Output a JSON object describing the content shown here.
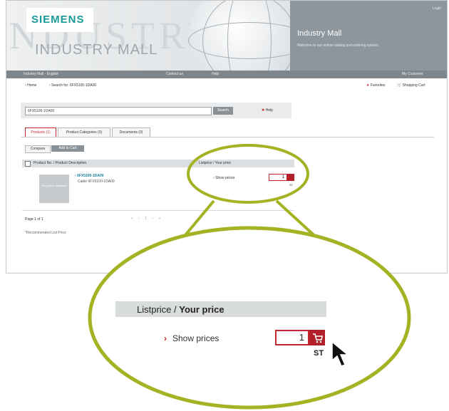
{
  "banner": {
    "logo": "SIEMENS",
    "title": "INDUSTRY MALL",
    "right_title": "Industry Mall",
    "right_text": "Welcome to our online catalog and ordering system",
    "top_link": "Login"
  },
  "navbar": {
    "left": "Industry Mall · English",
    "center_items": [
      "Contact us",
      "Help"
    ],
    "right": "My Customer"
  },
  "breadcrumb": {
    "home": "Home",
    "current": "Search for: 6FX5100-1DA00"
  },
  "header_links": {
    "favorites": "Favorites",
    "cart": "Shopping Cart"
  },
  "search": {
    "value": "6FX5100-1DA00",
    "button": "Search",
    "help": "Help"
  },
  "tabs": [
    {
      "label": "Products (1)"
    },
    {
      "label": "Product Categories (0)"
    },
    {
      "label": "Documents (0)"
    }
  ],
  "compare": {
    "compare_label": "Compare",
    "add_label": "Add to Cart"
  },
  "table": {
    "col1": "Product No. / Product Description",
    "col2": "Listprice / Your price",
    "row": {
      "title": "6FX5100-1DA00",
      "desc": "Cable 6FX5100-1DA00",
      "no_image": "No picture available",
      "show_prices": "Show prices",
      "qty": "1",
      "unit": "ST"
    }
  },
  "footer": {
    "page": "Page 1 of 1",
    "pager": "« ‹ 1 › »",
    "note": "*Recommended List Price"
  },
  "zoom": {
    "header_normal": "Listprice / ",
    "header_bold": "Your price",
    "show_prices": "Show prices",
    "qty": "1",
    "unit": "ST"
  },
  "colors": {
    "accent_red": "#c4262e",
    "brand_teal": "#189a98",
    "highlight_green": "#a3b324"
  }
}
